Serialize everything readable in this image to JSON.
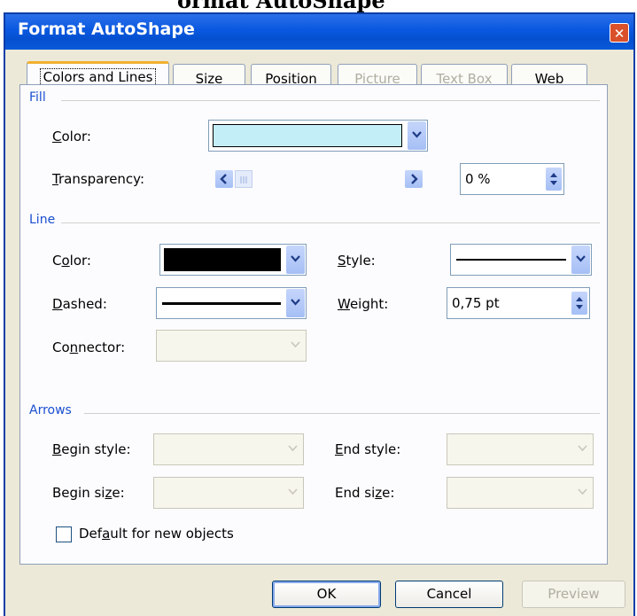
{
  "caption": "ormat AutoShape",
  "dialog": {
    "title": "Format AutoShape",
    "close_glyph": "✕"
  },
  "tabs": [
    {
      "label": "Colors and Lines",
      "state": "active"
    },
    {
      "label": "Size",
      "state": "normal"
    },
    {
      "label": "Position",
      "state": "normal"
    },
    {
      "label": "Picture",
      "state": "disabled"
    },
    {
      "label": "Text Box",
      "state": "disabled"
    },
    {
      "label": "Web",
      "state": "normal"
    }
  ],
  "fill": {
    "heading": "Fill",
    "color_label_pre": "",
    "color_label_key": "C",
    "color_label_post": "olor:",
    "color_value": "#c4eef7",
    "transparency_label_pre": "",
    "transparency_label_key": "T",
    "transparency_label_post": "ransparency:",
    "transparency_value": "0 %",
    "transparency_level": 0
  },
  "line": {
    "heading": "Line",
    "color_label_pre": "C",
    "color_label_key": "o",
    "color_label_post": "lor:",
    "color_value": "#000000",
    "style_label_pre": "",
    "style_label_key": "S",
    "style_label_post": "tyle:",
    "dashed_label_pre": "",
    "dashed_label_key": "D",
    "dashed_label_post": "ashed:",
    "weight_label_pre": "",
    "weight_label_key": "W",
    "weight_label_post": "eight:",
    "weight_value": "0,75 pt",
    "connector_label_pre": "Co",
    "connector_label_key": "n",
    "connector_label_post": "nector:"
  },
  "arrows": {
    "heading": "Arrows",
    "begin_style_pre": "",
    "begin_style_key": "B",
    "begin_style_post": "egin style:",
    "end_style_pre": "",
    "end_style_key": "E",
    "end_style_post": "nd style:",
    "begin_size_pre": "Begin si",
    "begin_size_key": "z",
    "begin_size_post": "e:",
    "end_size_pre": "End si",
    "end_size_key": "z",
    "end_size_post": "e:"
  },
  "default_checkbox": {
    "pre": "Def",
    "key": "a",
    "post": "ult for new objects",
    "checked": false
  },
  "buttons": {
    "ok": "OK",
    "cancel": "Cancel",
    "preview": "Preview"
  },
  "colors": {
    "accent_blue": "#1b4fd0",
    "titlebar": "#0a58e0",
    "dialog_bg": "#ece9d8"
  }
}
